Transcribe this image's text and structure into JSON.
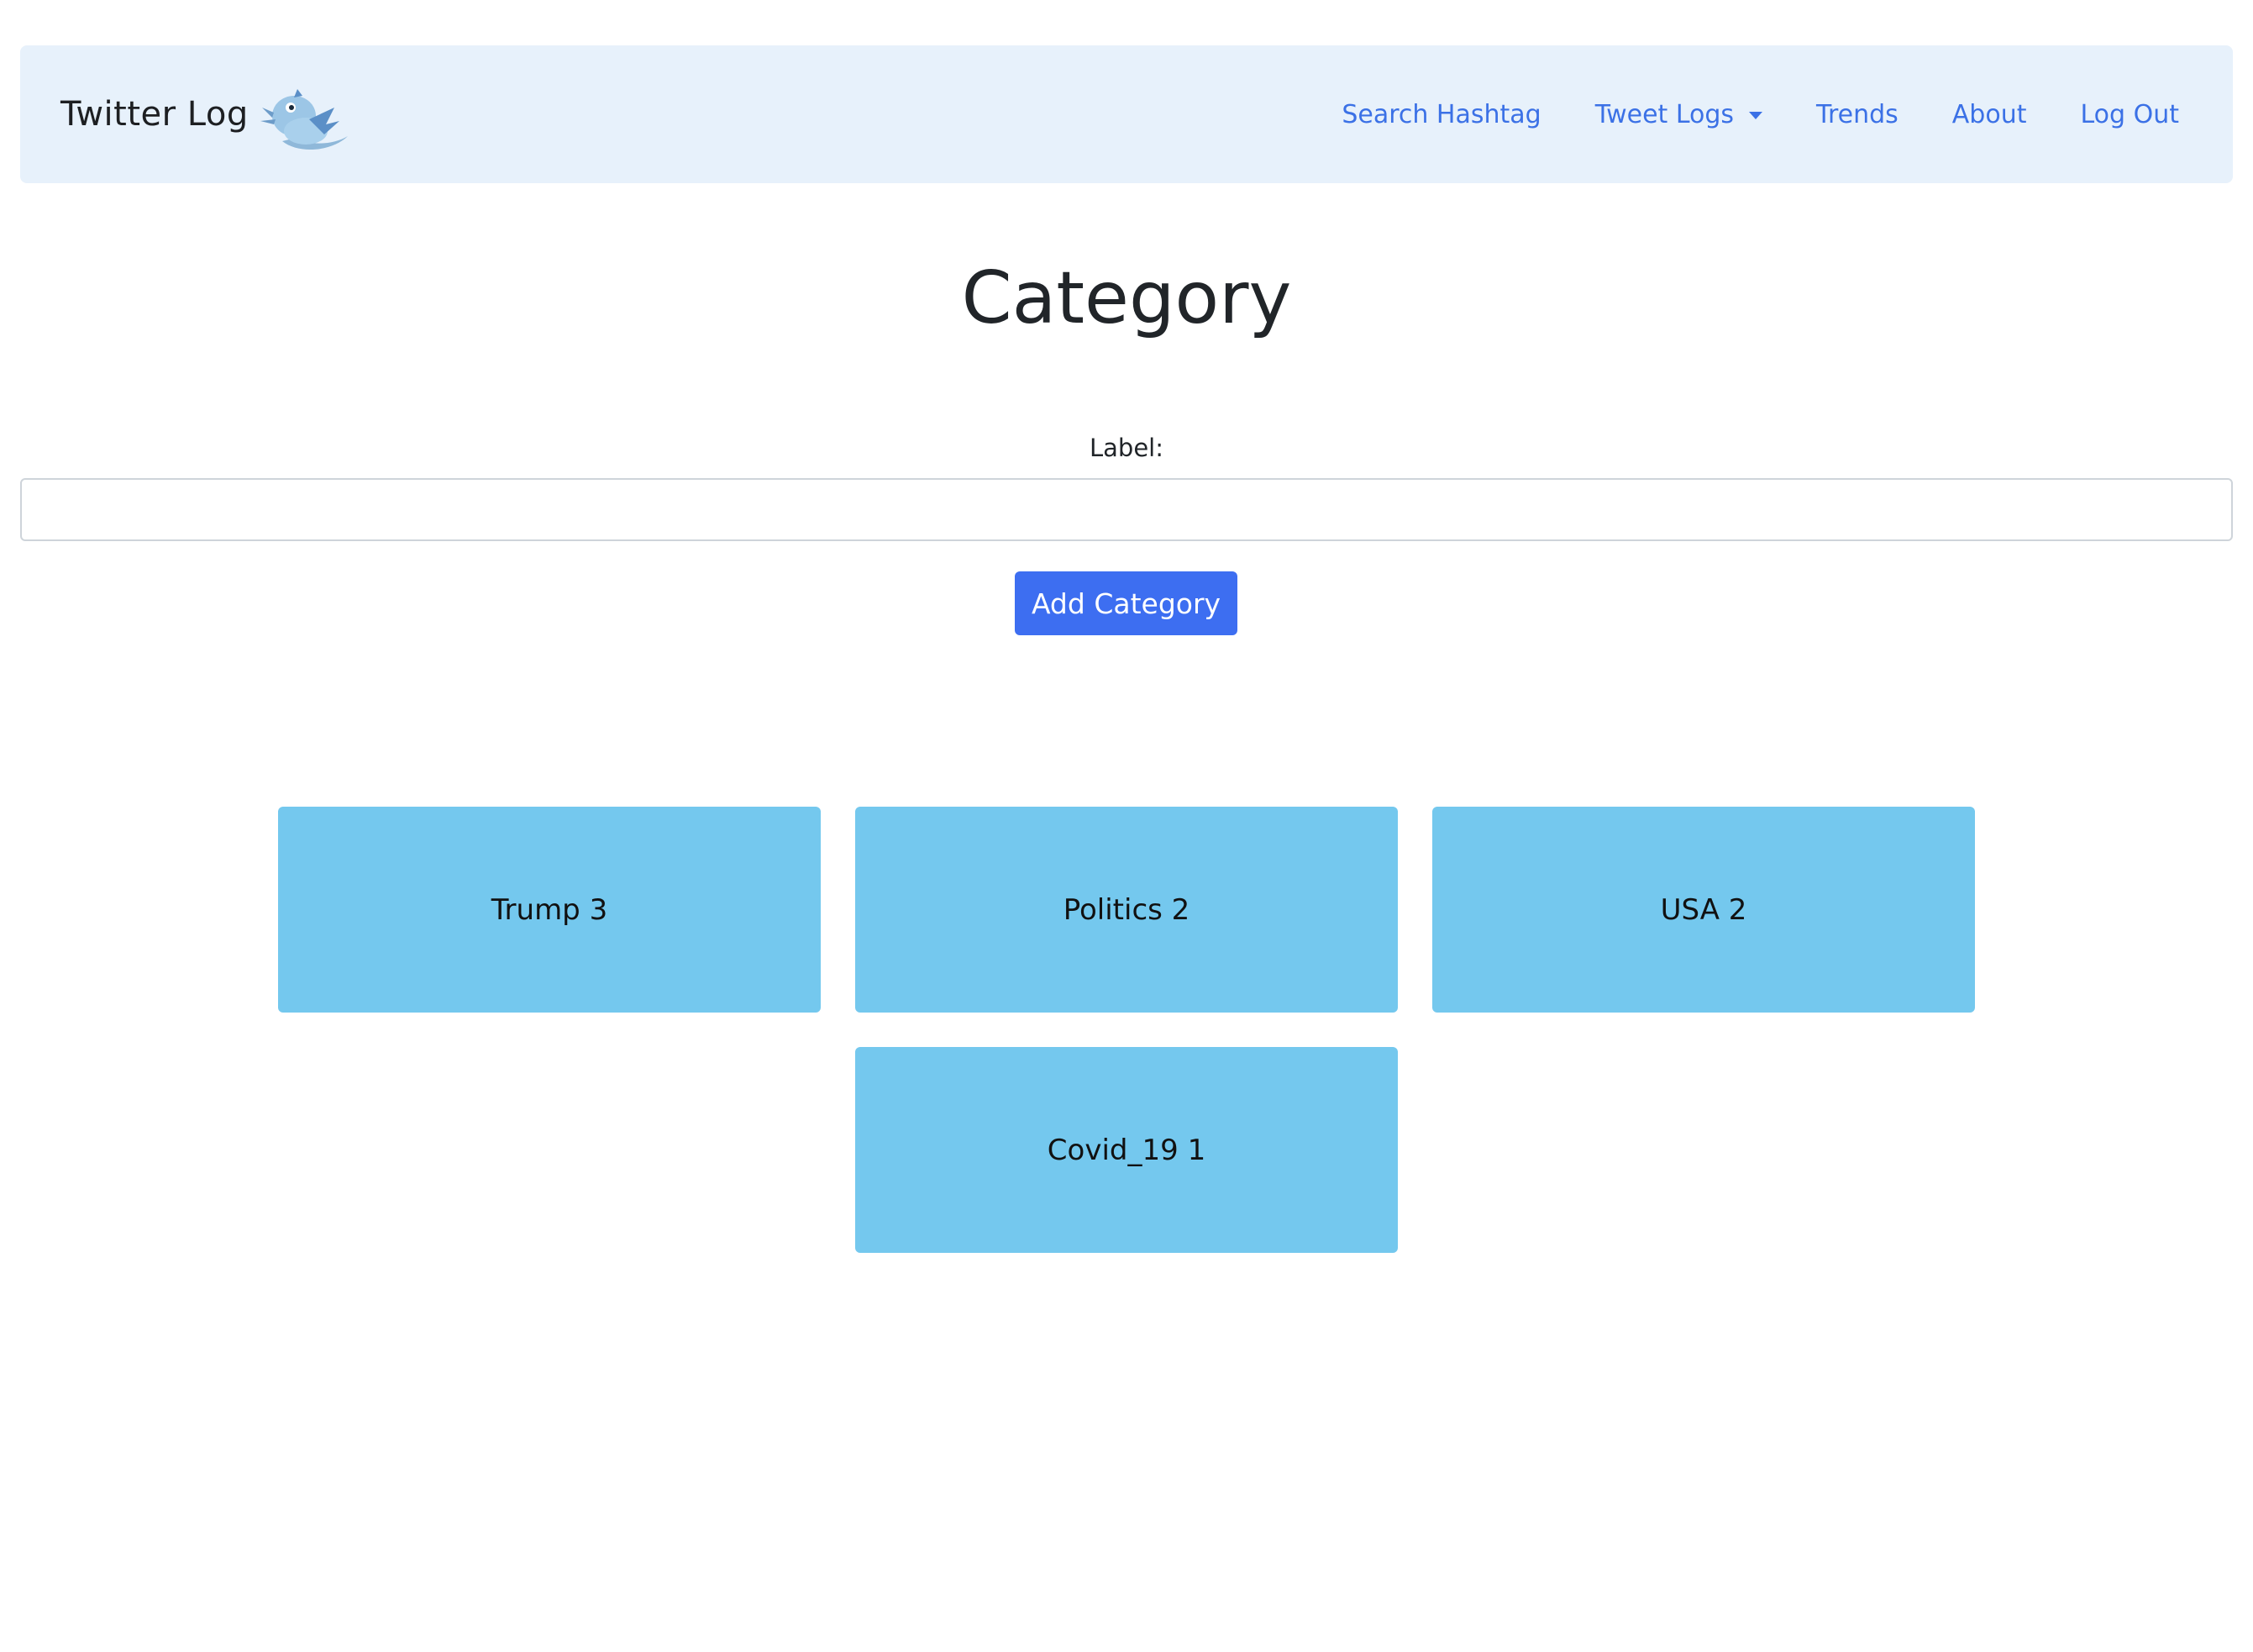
{
  "navbar": {
    "brand": "Twitter Log",
    "brand_logo_icon": "bird-icon",
    "links": [
      {
        "label": "Search Hashtag"
      },
      {
        "label": "Tweet Logs",
        "dropdown": true
      },
      {
        "label": "Trends"
      },
      {
        "label": "About"
      },
      {
        "label": "Log Out"
      }
    ]
  },
  "main": {
    "title": "Category",
    "form": {
      "label": "Label:",
      "input_value": "",
      "input_placeholder": "",
      "submit_label": "Add Category"
    },
    "categories": [
      {
        "name": "Trump",
        "count": "3"
      },
      {
        "name": "Politics",
        "count": "2"
      },
      {
        "name": "USA",
        "count": "2"
      },
      {
        "name": "Covid_19",
        "count": "1"
      }
    ]
  },
  "colors": {
    "navbar_bg": "#e7f1fb",
    "link": "#3b71e6",
    "button": "#3d6ef1",
    "card": "#74c8ee"
  }
}
